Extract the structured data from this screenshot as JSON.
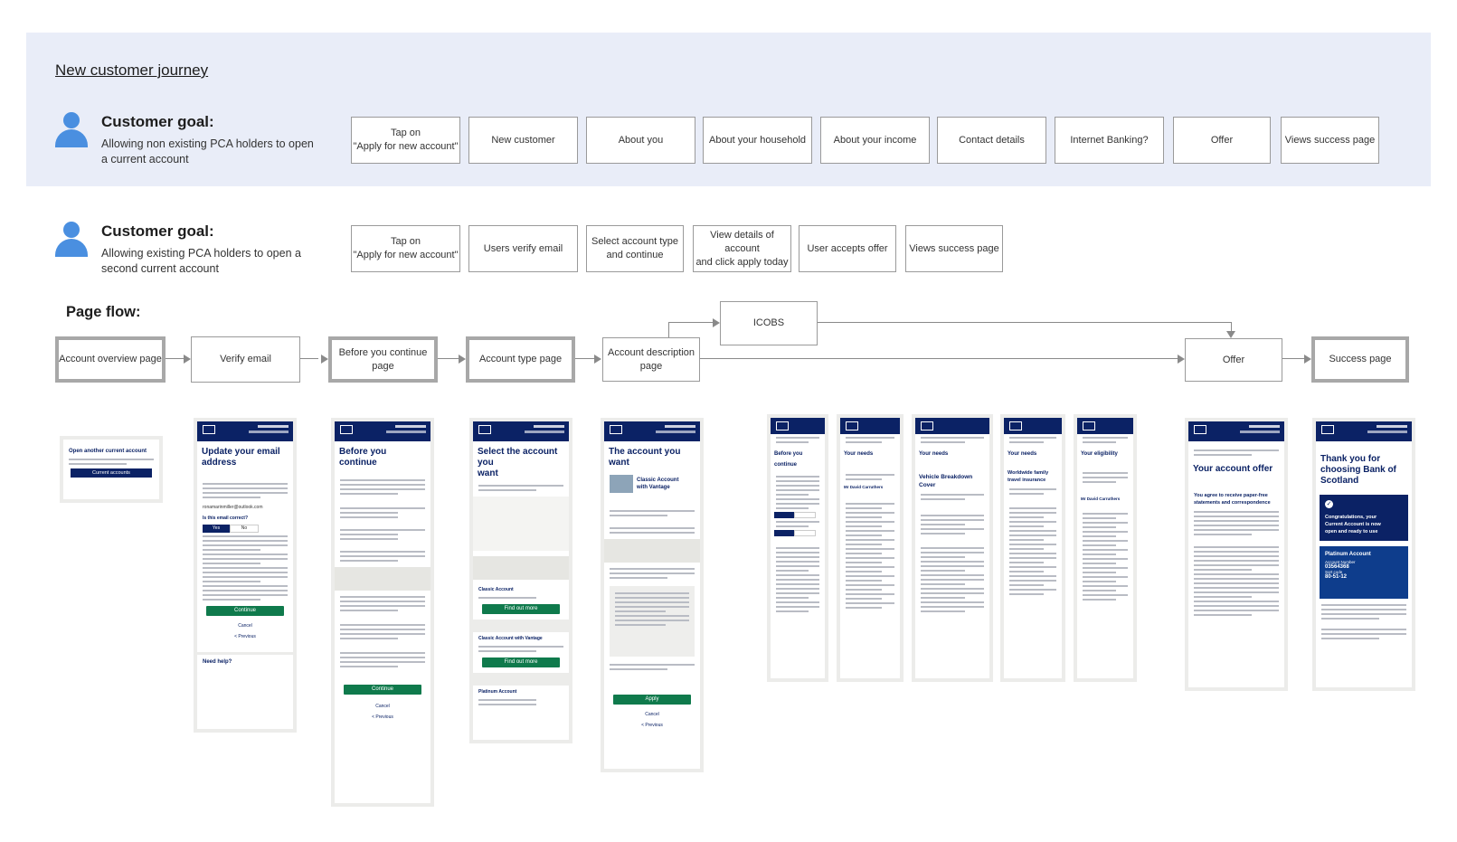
{
  "journey_title": "New customer journey",
  "goal_new": {
    "title": "Customer goal:",
    "desc": "Allowing non existing PCA holders to open a current account"
  },
  "goal_existing": {
    "title": "Customer goal:",
    "desc": "Allowing existing PCA holders to open a second current account"
  },
  "steps_new": [
    "Tap on\n\"Apply for new account\"",
    "New customer",
    "About you",
    "About your household",
    "About your income",
    "Contact details",
    "Internet Banking?",
    "Offer",
    "Views success page"
  ],
  "steps_existing": [
    "Tap on\n\"Apply for new account\"",
    "Users verify email",
    "Select account type\nand continue",
    "View details of account\nand click apply today",
    "User accepts offer",
    "Views success page"
  ],
  "flow": {
    "title": "Page flow:",
    "boxes": [
      "Account overview page",
      "Verify email",
      "Before you continue\npage",
      "Account type page",
      "Account description\npage",
      "ICOBS",
      "Offer",
      "Success page"
    ]
  },
  "screens": {
    "overview": {
      "title": "Open another current account",
      "button": "Current accounts"
    },
    "verify": {
      "title": "Update your email\naddress",
      "email": "ronamarinmiller@outlook.com",
      "question": "Is this email correct?",
      "yes": "Yes",
      "no": "No",
      "button": "Continue",
      "cancel": "Cancel",
      "previous": "< Previous",
      "help": "Need help?"
    },
    "before": {
      "title": "Before you continue",
      "button": "Continue",
      "cancel": "Cancel",
      "previous": "< Previous"
    },
    "type": {
      "title": "Select the account you\nwant",
      "acc1": "Classic Account",
      "acc2": "Classic Account with Vantage",
      "acc3": "Platinum Account",
      "find": "Find out more"
    },
    "description": {
      "title": "The account you want",
      "product": "Classic Account\nwith Vantage",
      "button": "Apply",
      "cancel": "Cancel",
      "previous": "< Previous"
    },
    "icobs": [
      {
        "title": "Before you continue"
      },
      {
        "title": "Your needs",
        "name": "Mr David Carruthers"
      },
      {
        "title": "Your needs",
        "sub": "Vehicle Breakdown\nCover"
      },
      {
        "title": "Your needs",
        "sub": "Worldwide family\ntravel insurance"
      },
      {
        "title": "Your eligibility",
        "name": "Mr David Carruthers"
      }
    ],
    "offer": {
      "title": "Your account offer",
      "sub": "You agree to receive paper-free\nstatements and correspondence"
    },
    "success": {
      "title": "Thank you for\nchoosing Bank of\nScotland",
      "msg": "Congratulations, your\nCurrent Account is now\nopen and ready to use",
      "acc": "Platinum Account",
      "acc_num_label": "Account Number",
      "acc_num": "03564368",
      "sort_label": "Sort code",
      "sort": "80-51-12"
    }
  },
  "colors": {
    "band": "#e9edf8",
    "person": "#4a8fe0",
    "bank_navy": "#0b2265",
    "cta_green": "#0f7a4c"
  }
}
